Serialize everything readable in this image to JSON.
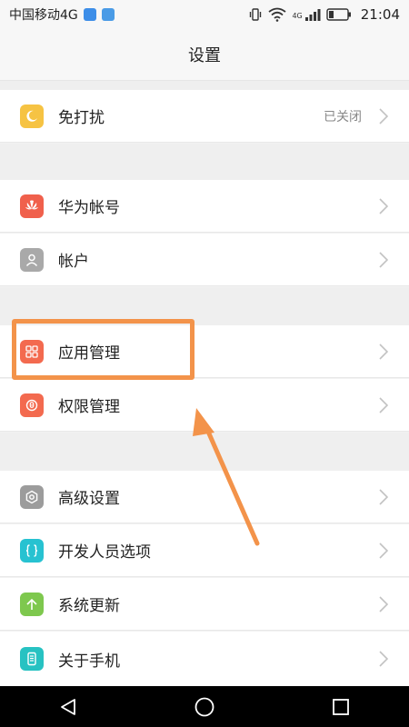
{
  "status_bar": {
    "carrier": "中国移动4G",
    "network_badge": "4G",
    "time": "21:04",
    "icons": [
      "notification-app-icon",
      "gallery-icon",
      "vibrate-icon",
      "wifi-icon",
      "signal-icon",
      "battery-icon"
    ]
  },
  "header": {
    "title": "设置"
  },
  "settings": {
    "items": [
      {
        "label": "免打扰",
        "value": "已关闭",
        "icon": "moon-icon",
        "color": "#f6c343"
      },
      {
        "label": "华为帐号",
        "icon": "huawei-icon",
        "color": "#f0604c"
      },
      {
        "label": "帐户",
        "icon": "account-icon",
        "color": "#a9a9a9"
      },
      {
        "label": "应用管理",
        "icon": "apps-grid-icon",
        "color": "#f36a4f"
      },
      {
        "label": "权限管理",
        "icon": "permission-icon",
        "color": "#f36a4f"
      },
      {
        "label": "高级设置",
        "icon": "gear-icon",
        "color": "#9c9c9c"
      },
      {
        "label": "开发人员选项",
        "icon": "braces-icon",
        "color": "#27c2d1"
      },
      {
        "label": "系统更新",
        "icon": "update-arrow-icon",
        "color": "#7ec84e"
      },
      {
        "label": "关于手机",
        "icon": "phone-icon",
        "color": "#27c2c2"
      }
    ]
  },
  "annotation": {
    "highlight_color": "#f3934a"
  },
  "nav_bar": {
    "buttons": [
      "back-icon",
      "home-icon",
      "recents-icon"
    ]
  }
}
